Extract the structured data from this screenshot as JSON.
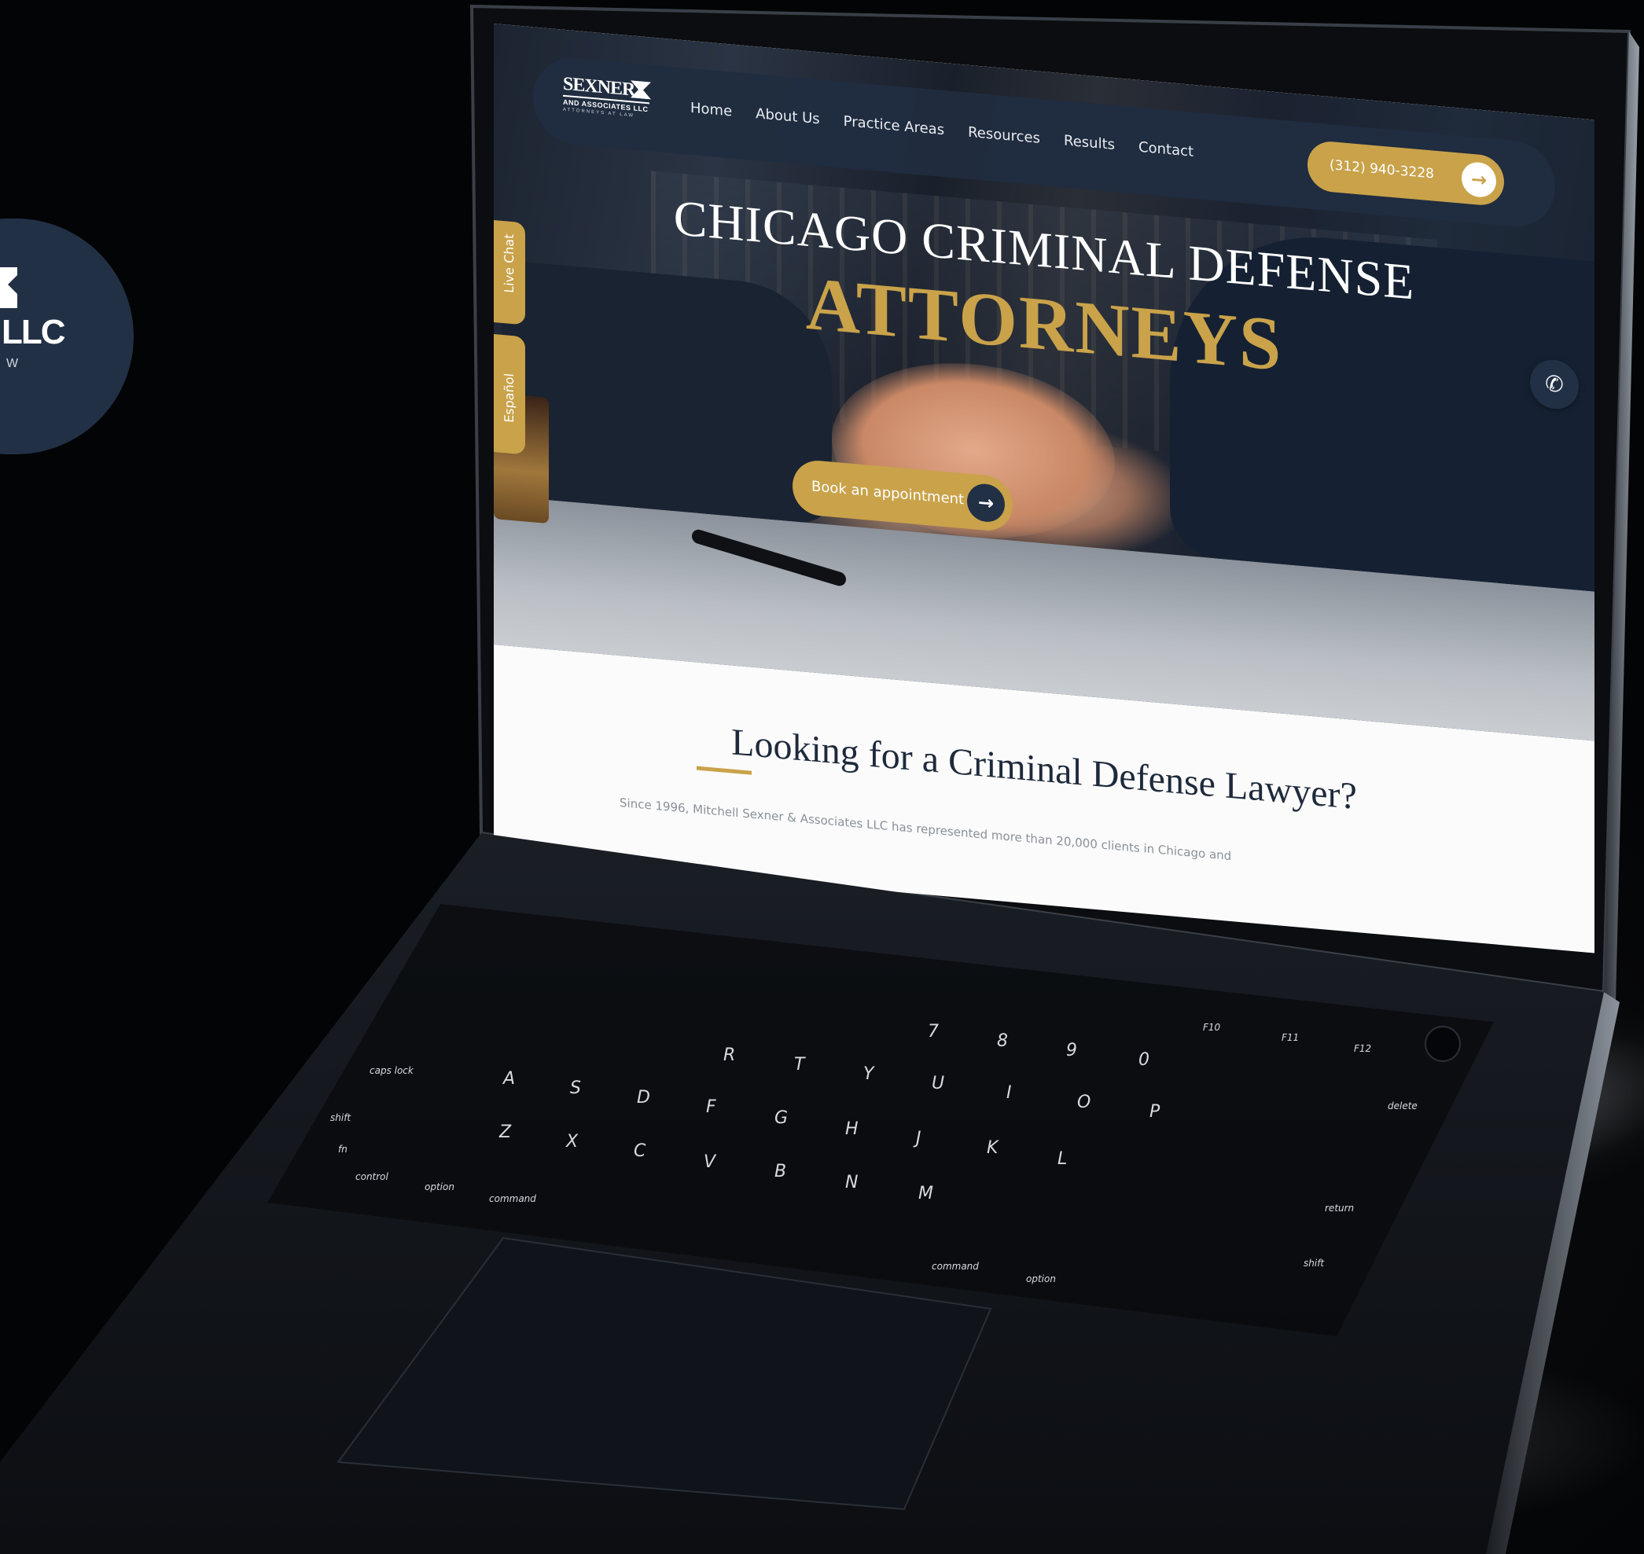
{
  "side_badge": {
    "llc": "LLC",
    "tail": "W"
  },
  "site": {
    "logo": {
      "line1": "SEXNER",
      "line2": "AND ASSOCIATES LLC",
      "line3": "ATTORNEYS AT LAW"
    },
    "nav": [
      "Home",
      "About Us",
      "Practice Areas",
      "Resources",
      "Results",
      "Contact"
    ],
    "phone": "(312) 940-3228",
    "hero_title": "CHICAGO CRIMINAL DEFENSE",
    "hero_subtitle": "ATTORNEYS",
    "book_button": "Book an appointment",
    "tabs": {
      "chat": "Live Chat",
      "espanol": "Español"
    },
    "section_title": "Looking for a Criminal Defense Lawyer?",
    "section_body": "Since 1996, Mitchell Sexner & Associates LLC has represented more than 20,000 clients in Chicago and"
  },
  "icons": {
    "arrow": "arrow-right-icon",
    "phone": "phone-icon"
  },
  "colors": {
    "navy": "#223046",
    "gold": "#c9a24a"
  },
  "keyboard": {
    "row_top": [
      "F10",
      "F11",
      "F12"
    ],
    "row_qwerty": [
      "R",
      "T",
      "Y",
      "U",
      "I",
      "O",
      "P"
    ],
    "row_home": [
      "caps lock",
      "A",
      "S",
      "D",
      "F",
      "G",
      "H",
      "J",
      "K",
      "L",
      "delete"
    ],
    "row_shift": [
      "shift",
      "Z",
      "X",
      "C",
      "V",
      "B",
      "N",
      "M",
      "return"
    ],
    "row_bottom": [
      "fn",
      "control",
      "option",
      "command",
      "command",
      "option",
      "shift"
    ],
    "numbers": [
      "7",
      "8",
      "9",
      "0"
    ]
  }
}
